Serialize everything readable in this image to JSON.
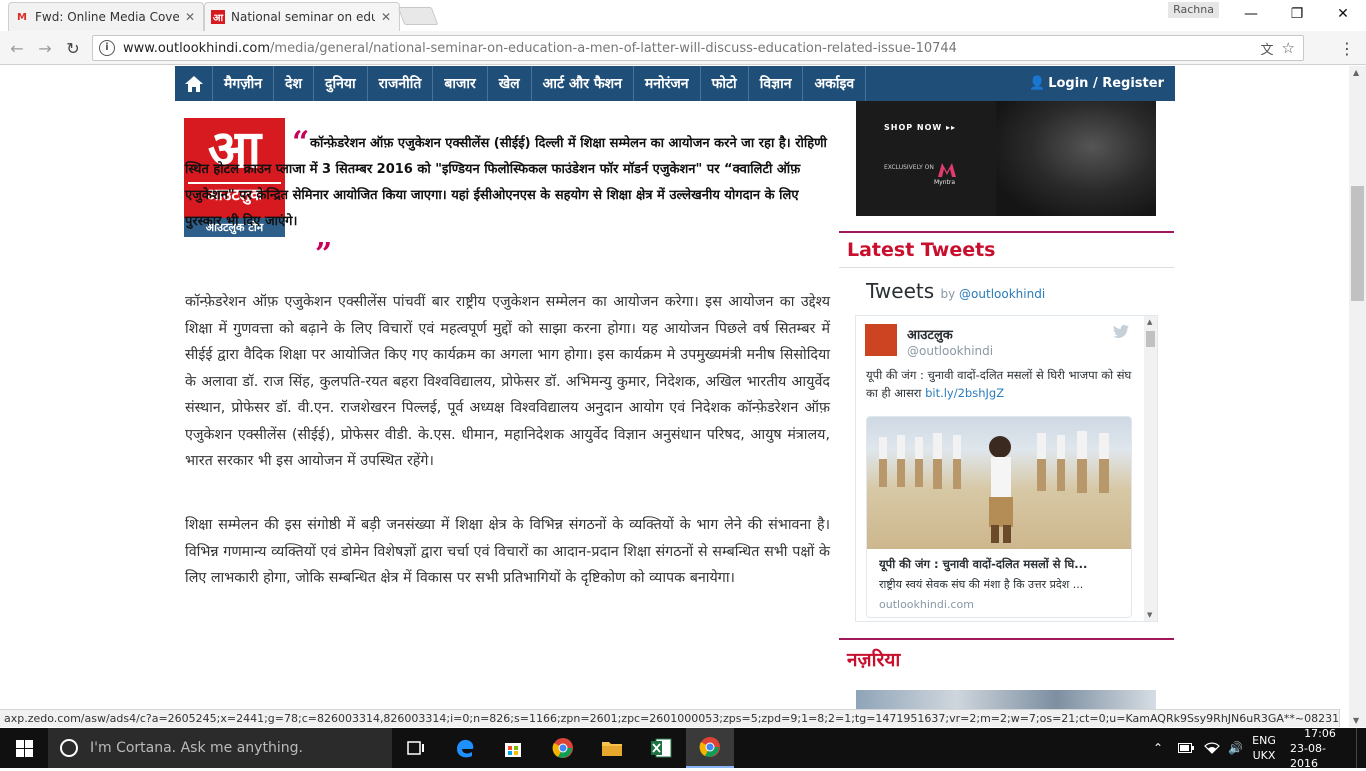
{
  "browser": {
    "tabs": [
      {
        "title": "Fwd: Online Media Cove",
        "icon": "gmail-icon"
      },
      {
        "title": "National seminar on edu",
        "icon": "outlook-favicon"
      }
    ],
    "profile_name": "Rachna",
    "url_host": "www.outlookhindi.com",
    "url_path": "/media/general/national-seminar-on-education-a-men-of-latter-will-discuss-education-related-issue-10744"
  },
  "sitenav": {
    "items": [
      "मैगज़ीन",
      "देश",
      "दुनिया",
      "राजनीति",
      "बाजार",
      "खेल",
      "आर्ट और फैशन",
      "मनोरंजन",
      "फोटो",
      "विज्ञान",
      "अर्काइव"
    ],
    "login": "Login / Register"
  },
  "article": {
    "logo_big": "आ",
    "logo_small": "आउटलुक",
    "author": "आउटलुक टीम",
    "lead": "कॉन्फ़ेडरेशन ऑफ़ एजुकेशन एक्सीलेंस (सीईई) दिल्ली में शिक्षा सम्मेलन का आयोजन करने जा रहा है। रोहिणी स्थित होटल क्राउन प्लाजा में 3 सितम्बर 2016 को \"इण्डियन फिलोस्फिकल फाउंडेशन फॉर मॉडर्न एजुकेशन\" पर “क्वालिटी ऑफ़ एजुकेशन\" पर केन्द्रित सेमिनार आयोजित किया जाएगा। यहां ईसीओएनएस के सहयोग से शिक्षा क्षेत्र में उल्लेखनीय योगदान के लिए पुरस्कार भी दिए जाएंगे।",
    "paragraphs": [
      "कॉन्फ़ेडरेशन ऑफ़ एजुकेशन एक्सीलेंस पांचवीं बार राष्ट्रीय एजुकेशन सम्मेलन का आयोजन करेगा। इस आयोजन का उद्देश्य शिक्षा में गुणवत्ता को बढ़ाने के लिए विचारों एवं महत्वपूर्ण मुद्दों को साझा करना होगा। यह आयोजन पिछले वर्ष सितम्बर में सीईई द्वारा वैदिक शिक्षा पर आयोजित किए गए कार्यक्रम का अगला भाग होगा। इस कार्यक्रम मे उपमुख्यमंत्री मनीष सिसोदिया के अलावा डॉ. राज सिंह, कुलपति-रयत बहरा विश्वविद्यालय, प्रोफेसर डॉ. अभिमन्यु कुमार, निदेशक, अखिल भारतीय आयुर्वेद संस्थान, प्रोफेसर डॉ. वी.एन. राजशेखरन पिल्लई, पूर्व अध्यक्ष विश्वविद्यालय अनुदान आयोग एवं निदेशक कॉन्फ़ेडरेशन ऑफ़ एजुकेशन एक्सीलेंस (सीईई), प्रोफेसर वीडी. के.एस. धीमान, महानिदेशक आयुर्वेद विज्ञान अनुसंधान परिषद, आयुष मंत्रालय, भारत सरकार भी इस आयोजन में उपस्थित रहेंगे।",
      "शिक्षा सम्मेलन की इस संगोष्ठी में बड़ी जनसंख्या में शिक्षा क्षेत्र के विभिन्न संगठनों के व्यक्तियों के भाग लेने की संभावना है। विभिन्न गणमान्य व्यक्तियों एवं डोमेन विशेषज्ञों द्वारा चर्चा एवं विचारों का आदान-प्रदान शिक्षा संगठनों से सम्बन्धित सभी पक्षों के लिए लाभकारी होगा, जोकि सम्बन्धित क्षेत्र में विकास पर सभी प्रतिभागियों के दृष्टिकोण को व्यापक बनायेगा।"
    ]
  },
  "ad": {
    "shop_now": "SHOP NOW",
    "exclusive": "EXCLUSIVELY ON",
    "brand": "Myntra"
  },
  "sidebar": {
    "latest_tweets": "Latest Tweets",
    "tweets_heading": "Tweets",
    "tweets_by": "by",
    "tweets_handle": "@outlookhindi",
    "tweet": {
      "name": "आउटलुक",
      "handle": "@outlookhindi",
      "text": "यूपी की जंग : चुनावी वादों-दलित मसलों से घिरी भाजपा को संघ का ही आसरा",
      "link": "bit.ly/2bshJgZ",
      "card_title": "यूपी की जंग : चुनावी वादों-दलित मसलों से घि...",
      "card_desc": "राष्ट्रीय स्वयं सेवक संघ की मंशा है कि उत्तर प्रदेश ...",
      "card_domain": "outlookhindi.com"
    },
    "nazariya": "नज़रिया"
  },
  "statusbar": "axp.zedo.com/asw/ads4/c?a=2605245;x=2441;g=78;c=826003314,826003314;i=0;n=826;s=1166;zpn=2601;zpc=2601000053;zps=5;zpd=9;1=8;2=1;tg=1471951637;vr=2;m=2;w=7;os=21;ct=0;u=KamAQRk9Ssy9RhJN6uR3GA**~082316;ai=;z=0.1957502...",
  "taskbar": {
    "search_placeholder": "I'm Cortana. Ask me anything.",
    "lang_top": "ENG",
    "lang_bottom": "UKX",
    "time": "17:06",
    "date": "23-08-2016"
  }
}
